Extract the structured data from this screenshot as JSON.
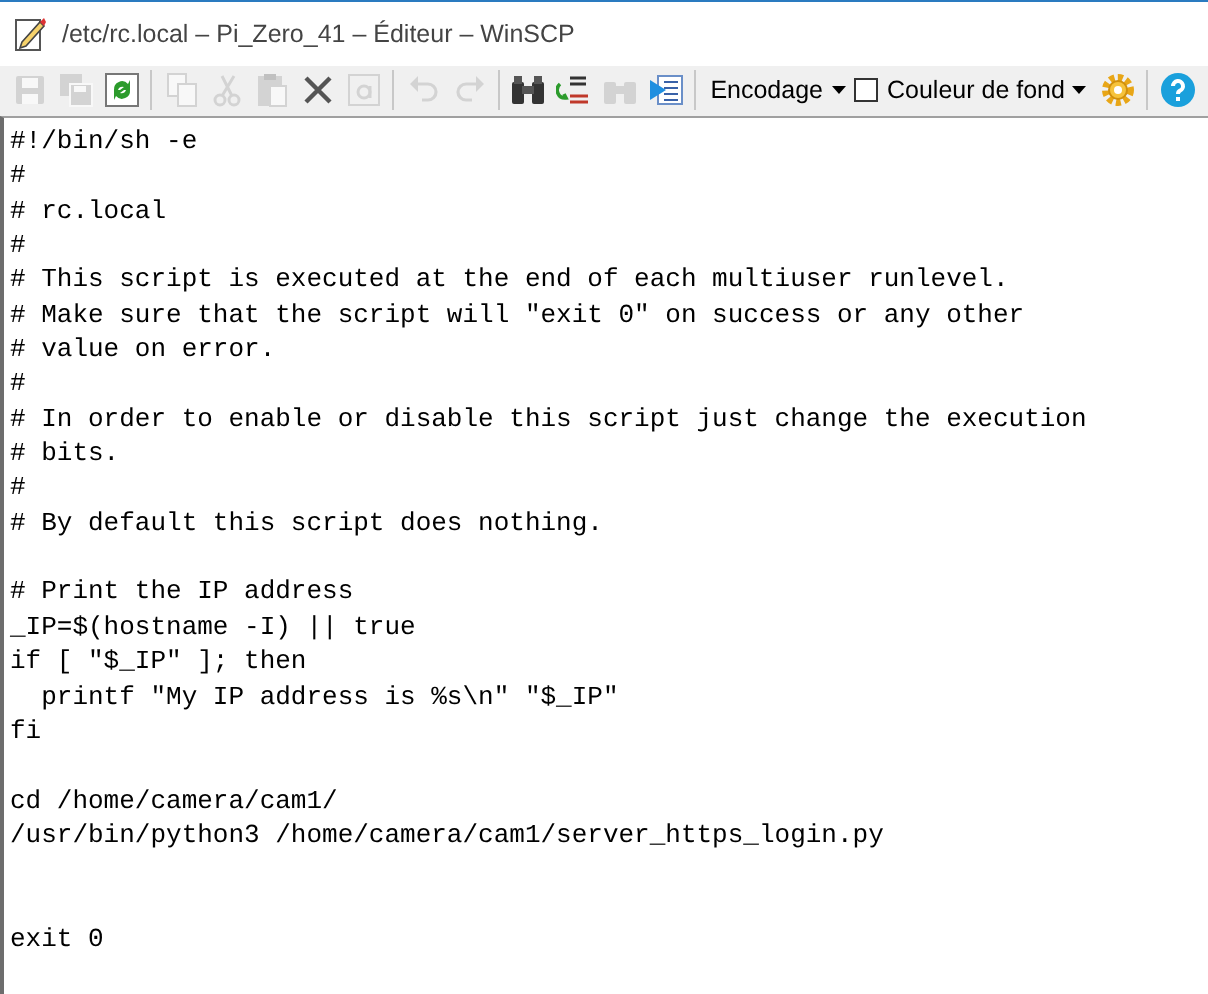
{
  "window": {
    "title": "/etc/rc.local – Pi_Zero_41 – Éditeur – WinSCP"
  },
  "toolbar": [
    {
      "kind": "save",
      "disabled": true
    },
    {
      "kind": "save-all",
      "disabled": true
    },
    {
      "kind": "refresh",
      "disabled": false
    },
    {
      "kind": "separator"
    },
    {
      "kind": "copy",
      "disabled": true
    },
    {
      "kind": "cut",
      "disabled": true
    },
    {
      "kind": "paste",
      "disabled": true
    },
    {
      "kind": "delete",
      "disabled": false
    },
    {
      "kind": "select-all",
      "disabled": true
    },
    {
      "kind": "separator"
    },
    {
      "kind": "undo",
      "disabled": true
    },
    {
      "kind": "redo",
      "disabled": true
    },
    {
      "kind": "separator"
    },
    {
      "kind": "find",
      "disabled": false
    },
    {
      "kind": "replace",
      "disabled": false
    },
    {
      "kind": "find-next",
      "disabled": true
    },
    {
      "kind": "goto",
      "disabled": false
    },
    {
      "kind": "separator"
    },
    {
      "kind": "dropdown",
      "label": "Encodage"
    },
    {
      "kind": "checkbox",
      "label": "Couleur de fond",
      "checked": false
    },
    {
      "kind": "settings",
      "disabled": false
    },
    {
      "kind": "separator"
    },
    {
      "kind": "help",
      "disabled": false
    }
  ],
  "editor": {
    "content": "#!/bin/sh -e\n#\n# rc.local\n#\n# This script is executed at the end of each multiuser runlevel.\n# Make sure that the script will \"exit 0\" on success or any other\n# value on error.\n#\n# In order to enable or disable this script just change the execution\n# bits.\n#\n# By default this script does nothing.\n\n# Print the IP address\n_IP=$(hostname -I) || true\nif [ \"$_IP\" ]; then\n  printf \"My IP address is %s\\n\" \"$_IP\"\nfi\n\ncd /home/camera/cam1/\n/usr/bin/python3 /home/camera/cam1/server_https_login.py\n\n\nexit 0"
  }
}
